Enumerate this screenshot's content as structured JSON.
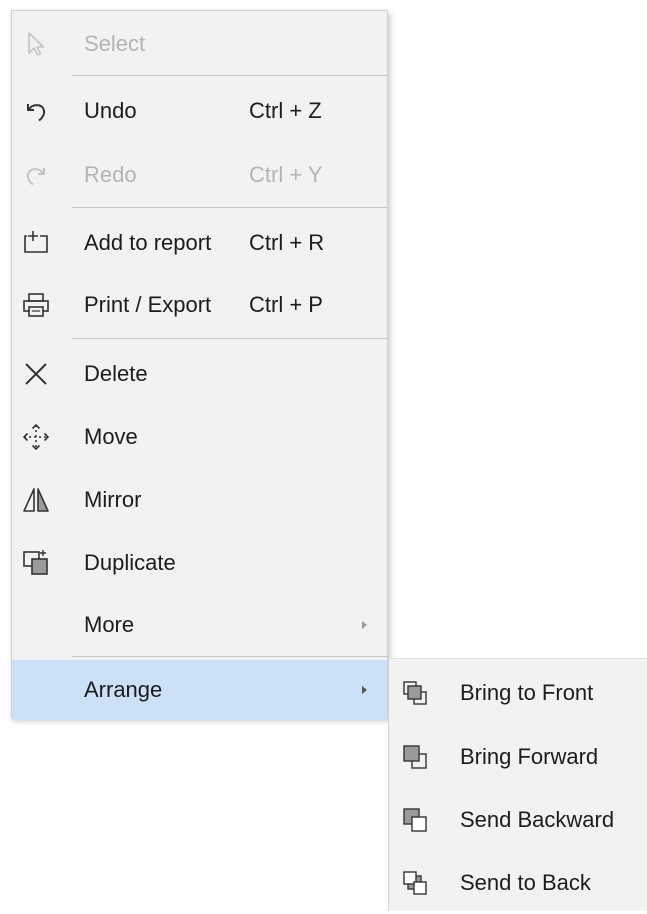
{
  "menu": {
    "select": {
      "label": "Select",
      "icon": "cursor-icon"
    },
    "undo": {
      "label": "Undo",
      "shortcut": "Ctrl + Z",
      "icon": "undo-icon"
    },
    "redo": {
      "label": "Redo",
      "shortcut": "Ctrl + Y",
      "icon": "redo-icon"
    },
    "add_to_report": {
      "label": "Add to report",
      "shortcut": "Ctrl + R",
      "icon": "add-to-report-icon"
    },
    "print_export": {
      "label": "Print / Export",
      "shortcut": "Ctrl + P",
      "icon": "printer-icon"
    },
    "delete": {
      "label": "Delete",
      "icon": "close-x-icon"
    },
    "move": {
      "label": "Move",
      "icon": "move-arrows-icon"
    },
    "mirror": {
      "label": "Mirror",
      "icon": "mirror-icon"
    },
    "duplicate": {
      "label": "Duplicate",
      "icon": "duplicate-icon"
    },
    "more": {
      "label": "More",
      "icon": "submenu-arrow-icon"
    },
    "arrange": {
      "label": "Arrange",
      "icon": "submenu-arrow-icon"
    }
  },
  "submenu": {
    "bring_to_front": {
      "label": "Bring to Front",
      "icon": "bring-to-front-icon"
    },
    "bring_forward": {
      "label": "Bring Forward",
      "icon": "bring-forward-icon"
    },
    "send_backward": {
      "label": "Send Backward",
      "icon": "send-backward-icon"
    },
    "send_to_back": {
      "label": "Send to Back",
      "icon": "send-to-back-icon"
    }
  },
  "colors": {
    "menu_background": "#f2f2f2",
    "highlight": "#cce0f7",
    "disabled_text": "#b4b4b4",
    "text": "#1c1c1c"
  }
}
